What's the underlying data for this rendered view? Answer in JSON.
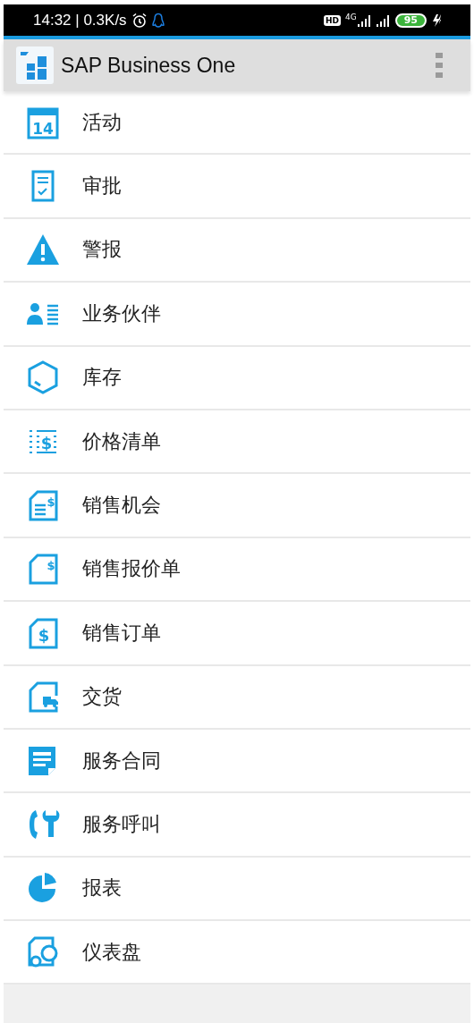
{
  "status_bar": {
    "time_speed": "14:32 | 0.3K/s",
    "hd_badge": "HD",
    "network": "4G",
    "battery": "95"
  },
  "app_bar": {
    "title": "SAP Business One"
  },
  "menu": [
    {
      "kind": "calendar",
      "label": "活动",
      "glyph": "14"
    },
    {
      "kind": "approval",
      "label": "审批"
    },
    {
      "kind": "alert",
      "label": "警报"
    },
    {
      "kind": "partner",
      "label": "业务伙伴"
    },
    {
      "kind": "inventory",
      "label": "库存"
    },
    {
      "kind": "price_list",
      "label": "价格清单",
      "glyph": "$"
    },
    {
      "kind": "opportunity",
      "label": "销售机会",
      "glyph": "$"
    },
    {
      "kind": "quotation",
      "label": "销售报价单",
      "glyph": "$"
    },
    {
      "kind": "order",
      "label": "销售订单",
      "glyph": "$"
    },
    {
      "kind": "delivery",
      "label": "交货"
    },
    {
      "kind": "contract",
      "label": "服务合同"
    },
    {
      "kind": "service_call",
      "label": "服务呼叫"
    },
    {
      "kind": "report",
      "label": "报表"
    },
    {
      "kind": "dashboard",
      "label": "仪表盘"
    }
  ]
}
